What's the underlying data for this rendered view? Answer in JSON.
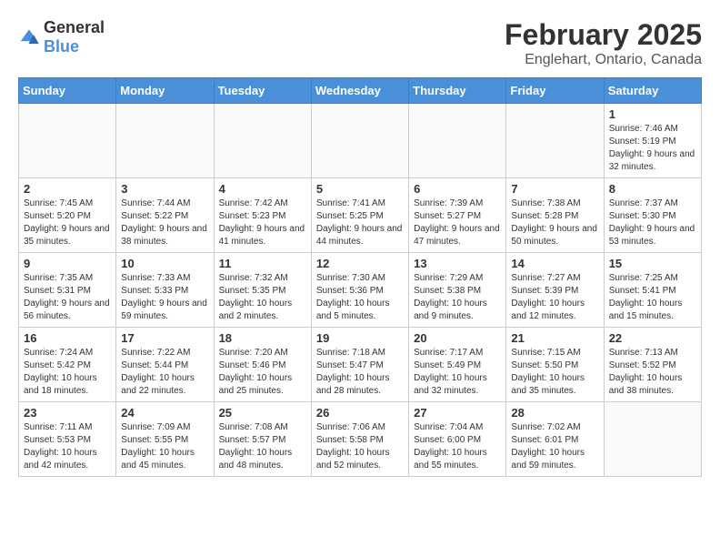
{
  "logo": {
    "text_general": "General",
    "text_blue": "Blue"
  },
  "calendar": {
    "title": "February 2025",
    "subtitle": "Englehart, Ontario, Canada"
  },
  "headers": [
    "Sunday",
    "Monday",
    "Tuesday",
    "Wednesday",
    "Thursday",
    "Friday",
    "Saturday"
  ],
  "weeks": [
    [
      {
        "day": "",
        "info": ""
      },
      {
        "day": "",
        "info": ""
      },
      {
        "day": "",
        "info": ""
      },
      {
        "day": "",
        "info": ""
      },
      {
        "day": "",
        "info": ""
      },
      {
        "day": "",
        "info": ""
      },
      {
        "day": "1",
        "info": "Sunrise: 7:46 AM\nSunset: 5:19 PM\nDaylight: 9 hours and 32 minutes."
      }
    ],
    [
      {
        "day": "2",
        "info": "Sunrise: 7:45 AM\nSunset: 5:20 PM\nDaylight: 9 hours and 35 minutes."
      },
      {
        "day": "3",
        "info": "Sunrise: 7:44 AM\nSunset: 5:22 PM\nDaylight: 9 hours and 38 minutes."
      },
      {
        "day": "4",
        "info": "Sunrise: 7:42 AM\nSunset: 5:23 PM\nDaylight: 9 hours and 41 minutes."
      },
      {
        "day": "5",
        "info": "Sunrise: 7:41 AM\nSunset: 5:25 PM\nDaylight: 9 hours and 44 minutes."
      },
      {
        "day": "6",
        "info": "Sunrise: 7:39 AM\nSunset: 5:27 PM\nDaylight: 9 hours and 47 minutes."
      },
      {
        "day": "7",
        "info": "Sunrise: 7:38 AM\nSunset: 5:28 PM\nDaylight: 9 hours and 50 minutes."
      },
      {
        "day": "8",
        "info": "Sunrise: 7:37 AM\nSunset: 5:30 PM\nDaylight: 9 hours and 53 minutes."
      }
    ],
    [
      {
        "day": "9",
        "info": "Sunrise: 7:35 AM\nSunset: 5:31 PM\nDaylight: 9 hours and 56 minutes."
      },
      {
        "day": "10",
        "info": "Sunrise: 7:33 AM\nSunset: 5:33 PM\nDaylight: 9 hours and 59 minutes."
      },
      {
        "day": "11",
        "info": "Sunrise: 7:32 AM\nSunset: 5:35 PM\nDaylight: 10 hours and 2 minutes."
      },
      {
        "day": "12",
        "info": "Sunrise: 7:30 AM\nSunset: 5:36 PM\nDaylight: 10 hours and 5 minutes."
      },
      {
        "day": "13",
        "info": "Sunrise: 7:29 AM\nSunset: 5:38 PM\nDaylight: 10 hours and 9 minutes."
      },
      {
        "day": "14",
        "info": "Sunrise: 7:27 AM\nSunset: 5:39 PM\nDaylight: 10 hours and 12 minutes."
      },
      {
        "day": "15",
        "info": "Sunrise: 7:25 AM\nSunset: 5:41 PM\nDaylight: 10 hours and 15 minutes."
      }
    ],
    [
      {
        "day": "16",
        "info": "Sunrise: 7:24 AM\nSunset: 5:42 PM\nDaylight: 10 hours and 18 minutes."
      },
      {
        "day": "17",
        "info": "Sunrise: 7:22 AM\nSunset: 5:44 PM\nDaylight: 10 hours and 22 minutes."
      },
      {
        "day": "18",
        "info": "Sunrise: 7:20 AM\nSunset: 5:46 PM\nDaylight: 10 hours and 25 minutes."
      },
      {
        "day": "19",
        "info": "Sunrise: 7:18 AM\nSunset: 5:47 PM\nDaylight: 10 hours and 28 minutes."
      },
      {
        "day": "20",
        "info": "Sunrise: 7:17 AM\nSunset: 5:49 PM\nDaylight: 10 hours and 32 minutes."
      },
      {
        "day": "21",
        "info": "Sunrise: 7:15 AM\nSunset: 5:50 PM\nDaylight: 10 hours and 35 minutes."
      },
      {
        "day": "22",
        "info": "Sunrise: 7:13 AM\nSunset: 5:52 PM\nDaylight: 10 hours and 38 minutes."
      }
    ],
    [
      {
        "day": "23",
        "info": "Sunrise: 7:11 AM\nSunset: 5:53 PM\nDaylight: 10 hours and 42 minutes."
      },
      {
        "day": "24",
        "info": "Sunrise: 7:09 AM\nSunset: 5:55 PM\nDaylight: 10 hours and 45 minutes."
      },
      {
        "day": "25",
        "info": "Sunrise: 7:08 AM\nSunset: 5:57 PM\nDaylight: 10 hours and 48 minutes."
      },
      {
        "day": "26",
        "info": "Sunrise: 7:06 AM\nSunset: 5:58 PM\nDaylight: 10 hours and 52 minutes."
      },
      {
        "day": "27",
        "info": "Sunrise: 7:04 AM\nSunset: 6:00 PM\nDaylight: 10 hours and 55 minutes."
      },
      {
        "day": "28",
        "info": "Sunrise: 7:02 AM\nSunset: 6:01 PM\nDaylight: 10 hours and 59 minutes."
      },
      {
        "day": "",
        "info": ""
      }
    ]
  ]
}
